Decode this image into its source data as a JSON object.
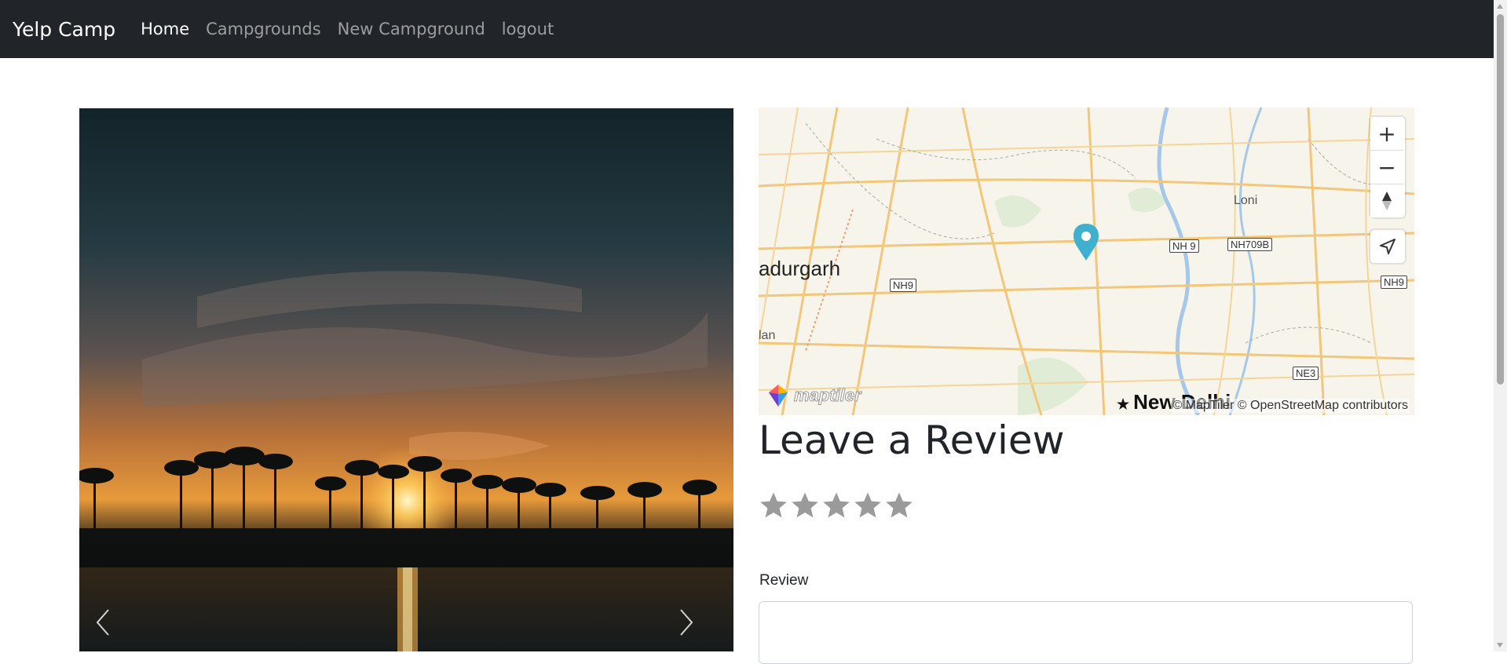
{
  "nav": {
    "brand": "Yelp Camp",
    "links": [
      "Home",
      "Campgrounds",
      "New Campground",
      "logout"
    ],
    "active": "Home"
  },
  "map": {
    "labels": {
      "bahadurgarh": "adurgarh",
      "loni": "Loni",
      "new_delhi": "New Delhi",
      "nilothi": "lan",
      "nh9_a": "NH9",
      "nh9_b": "NH 9",
      "nh9_c": "NH9",
      "nh709b": "NH709B",
      "ne3": "NE3"
    },
    "attribution": "© MapTiler © OpenStreetMap contributors",
    "logo_text": "maptiler",
    "controls": {
      "zoom_in": "+",
      "zoom_out": "−"
    }
  },
  "review": {
    "title": "Leave a Review",
    "rating_stars": 5,
    "rating_value": 0,
    "label": "Review",
    "text_value": ""
  },
  "colors": {
    "navbar_bg": "#212529",
    "star_empty": "#9a9a9a",
    "map_pin": "#3fb1ce"
  }
}
